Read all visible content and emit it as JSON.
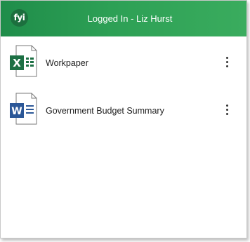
{
  "header": {
    "logo_text": "fyi",
    "title": "Logged In - Liz Hurst",
    "brand_color": "#2da055"
  },
  "files": [
    {
      "name": "Workpaper",
      "type": "excel",
      "icon": "excel-file-icon",
      "color": "#1d7044"
    },
    {
      "name": "Government Budget Summary",
      "type": "word",
      "icon": "word-file-icon",
      "color": "#2b5797"
    }
  ],
  "menu_icon": "more-vertical-icon"
}
